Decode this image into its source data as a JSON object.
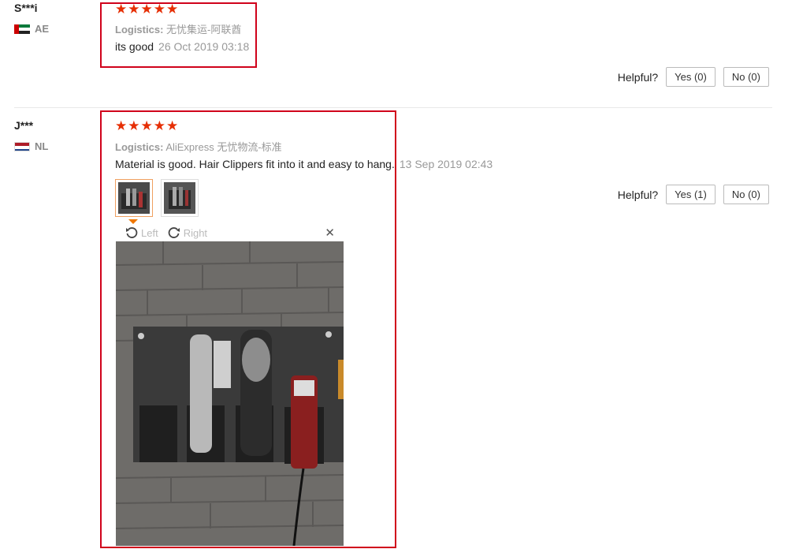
{
  "reviews": [
    {
      "user": "S***i",
      "country": "AE",
      "stars": 5,
      "logistics_label": "Logistics:",
      "logistics_value": "无忧集运-阿联酋",
      "text": "its good",
      "date": "26 Oct 2019 03:18",
      "helpful_label": "Helpful?",
      "yes_label": "Yes (0)",
      "no_label": "No (0)"
    },
    {
      "user": "J***",
      "country": "NL",
      "stars": 5,
      "logistics_label": "Logistics:",
      "logistics_value": "AliExpress 无忧物流-标准",
      "text": "Material is good. Hair Clippers fit into it and easy to hang.",
      "date": "13 Sep 2019 02:43",
      "helpful_label": "Helpful?",
      "yes_label": "Yes (1)",
      "no_label": "No (0)"
    }
  ],
  "viewer": {
    "rotate_left": "Left",
    "rotate_right": "Right",
    "close_symbol": "✕"
  },
  "colors": {
    "star": "#e62e04",
    "highlight_box": "#d0021b",
    "active_thumb_arrow": "#f07800"
  }
}
